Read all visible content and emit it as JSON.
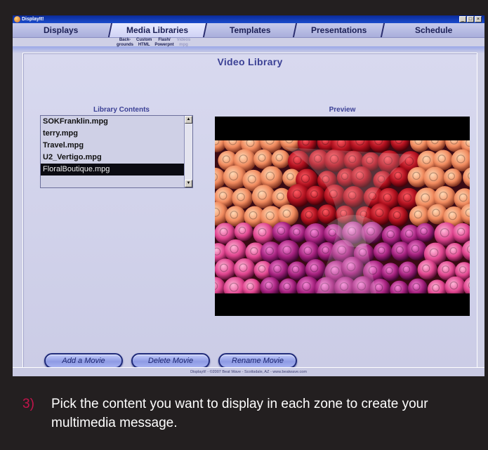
{
  "window": {
    "title": "DisplayIt!",
    "window_controls": [
      "_",
      "□",
      "×"
    ]
  },
  "tabs": [
    {
      "label": "Displays",
      "active": false
    },
    {
      "label": "Media Libraries",
      "active": true
    },
    {
      "label": "Templates",
      "active": false
    },
    {
      "label": "Presentations",
      "active": false
    },
    {
      "label": "Schedule",
      "active": false
    }
  ],
  "subtabs": [
    {
      "label": "Back-\ngrounds",
      "enabled": true
    },
    {
      "label": "Custom\nHTML",
      "enabled": true
    },
    {
      "label": "Flash/\nPowerpnt",
      "enabled": true
    },
    {
      "label": "Videos\nmpg",
      "enabled": false
    }
  ],
  "page": {
    "title": "Video Library",
    "library_label": "Library Contents",
    "preview_label": "Preview"
  },
  "library": {
    "items": [
      "SOKFranklin.mpg",
      "terry.mpg",
      "Travel.mpg",
      "U2_Vertigo.mpg",
      "FloralBoutique.mpg"
    ],
    "selected": "FloralBoutique.mpg"
  },
  "buttons": {
    "add": "Add a Movie",
    "delete": "Delete Movie",
    "rename": "Rename Movie"
  },
  "statusbar": {
    "text": "DisplayIt! - ©2007 Beat Wave - Scottsdale, AZ - www.beatwave.com"
  },
  "caption": {
    "step": "3)",
    "text": "Pick the content you want to display in each zone to create your multimedia message."
  },
  "colors": {
    "page_bg": "#231f20",
    "window_bg": "#cfd0e6",
    "heading": "#3b4095",
    "step_number": "#c2144b",
    "selection": "#0b0b12"
  }
}
